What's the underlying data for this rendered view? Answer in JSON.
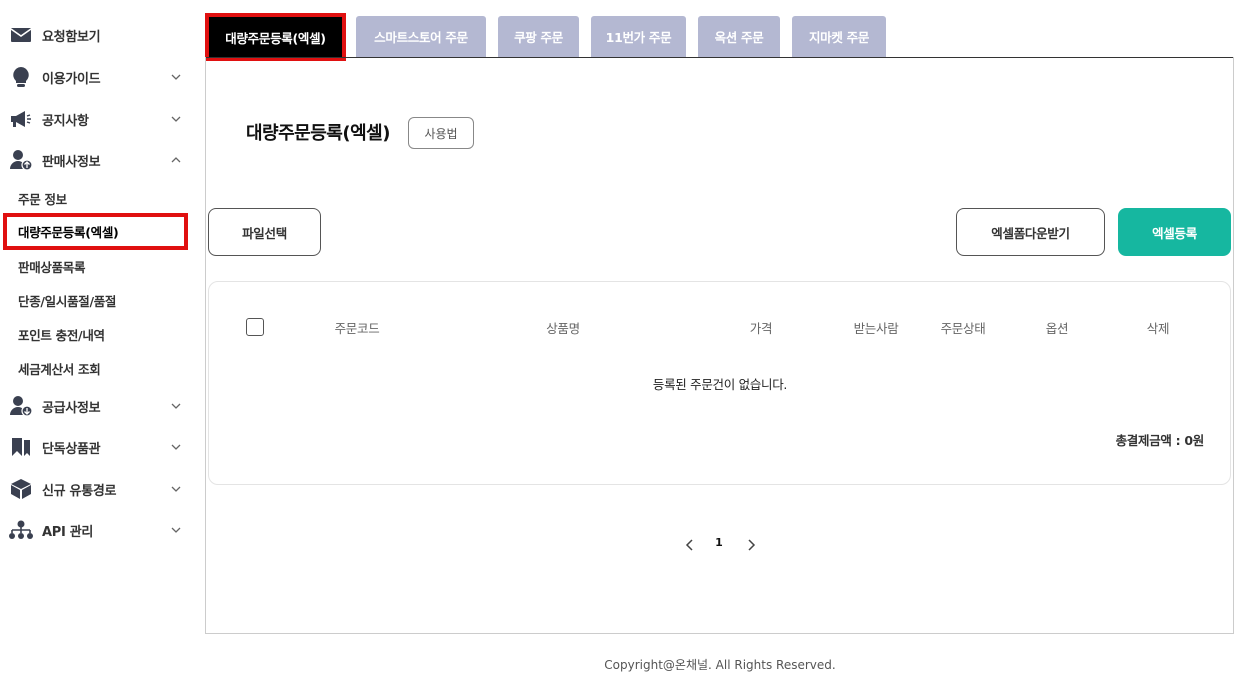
{
  "sidebar": {
    "items": [
      {
        "label": "요청함보기",
        "icon": "envelope-icon"
      },
      {
        "label": "이용가이드",
        "icon": "lightbulb-icon"
      },
      {
        "label": "공지사항",
        "icon": "megaphone-icon"
      },
      {
        "label": "판매사정보",
        "icon": "user-upload-icon"
      },
      {
        "label": "공급사정보",
        "icon": "user-download-icon"
      },
      {
        "label": "단독상품관",
        "icon": "bookmark-icon"
      },
      {
        "label": "신규 유통경로",
        "icon": "box-icon"
      },
      {
        "label": "API 관리",
        "icon": "sitemap-icon"
      }
    ],
    "sub_items": [
      {
        "label": "주문 정보"
      },
      {
        "label": "대량주문등록(엑셀)",
        "active": true
      },
      {
        "label": "판매상품목록"
      },
      {
        "label": "단종/일시품절/품절"
      },
      {
        "label": "포인트 충전/내역"
      },
      {
        "label": "세금계산서 조회"
      }
    ]
  },
  "tabs": [
    {
      "label": "대량주문등록(엑셀)",
      "active": true
    },
    {
      "label": "스마트스토어 주문"
    },
    {
      "label": "쿠팡 주문"
    },
    {
      "label": "11번가 주문"
    },
    {
      "label": "옥션 주문"
    },
    {
      "label": "지마켓 주문"
    }
  ],
  "main": {
    "title": "대량주문등록(엑셀)",
    "usage_button": "사용법",
    "file_select_button": "파일선택",
    "excel_form_download_button": "엑셀폼다운받기",
    "excel_register_button": "엑셀등록",
    "table": {
      "headers": [
        "주문코드",
        "상품명",
        "가격",
        "받는사람",
        "주문상태",
        "옵션",
        "삭제"
      ],
      "empty_message": "등록된 주문건이 없습니다.",
      "total_label": "총결제금액 : 0원"
    },
    "pagination": {
      "current_page": "1"
    }
  },
  "footer": {
    "copyright": "Copyright@온채널. All Rights Reserved."
  },
  "colors": {
    "accent": "#16b7a0",
    "tab_inactive": "#b4b8d2",
    "highlight": "#e01010"
  }
}
